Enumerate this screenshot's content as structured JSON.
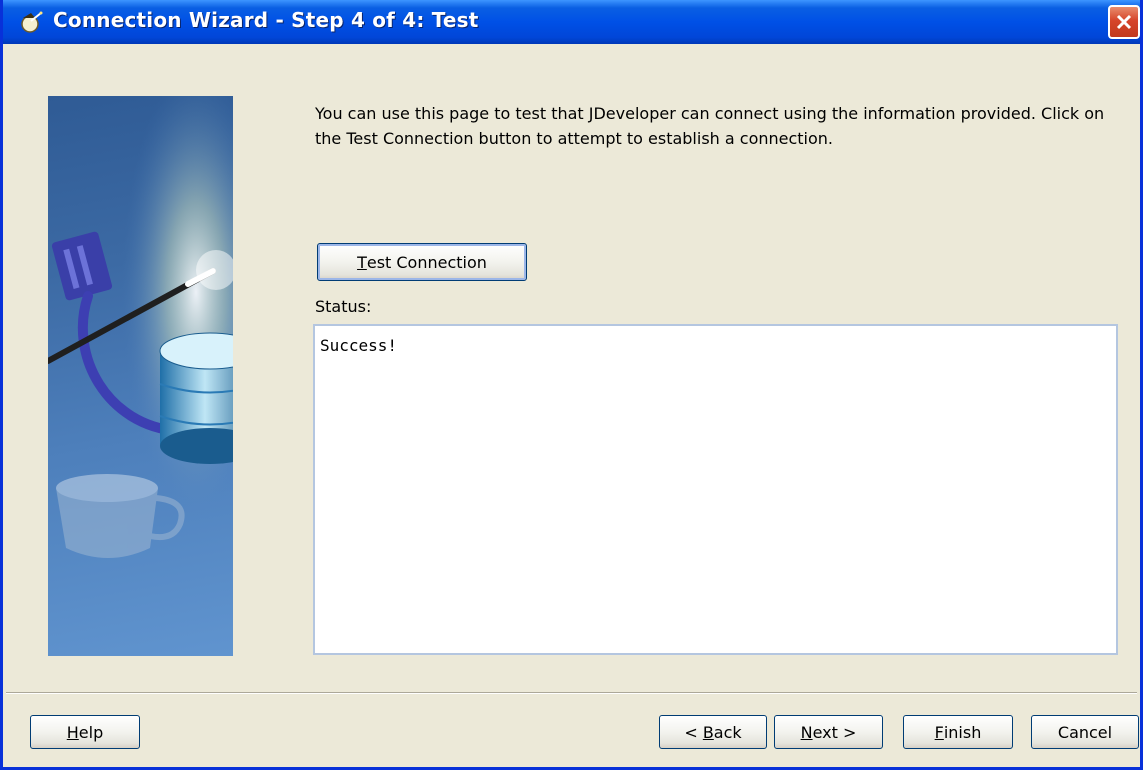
{
  "window": {
    "title": "Connection Wizard - Step 4 of 4: Test",
    "close_icon": "close-x-icon",
    "title_icon": "wizard-icon"
  },
  "image_panel": {
    "depicts": [
      "plug-icon",
      "wand-icon",
      "database-icon",
      "coffee-cup-icon"
    ]
  },
  "content": {
    "description": "You can use this page to test that JDeveloper can connect using the information provided.  Click on the Test Connection button to attempt to establish a connection.",
    "test_button": {
      "mnemonic": "T",
      "rest": "est Connection"
    },
    "status_label": "Status:",
    "status_text": "Success!"
  },
  "footer": {
    "help": {
      "mnemonic": "H",
      "rest": "elp"
    },
    "back": {
      "prefix": "< ",
      "mnemonic": "B",
      "rest": "ack"
    },
    "next": {
      "mnemonic": "N",
      "rest": "ext >"
    },
    "finish": {
      "mnemonic": "F",
      "rest": "inish"
    },
    "cancel": "Cancel"
  },
  "colors": {
    "titlebar": "#0050e6",
    "window_bg": "#ece9d8",
    "close_button": "#d6452a",
    "button_border": "#003c74"
  }
}
